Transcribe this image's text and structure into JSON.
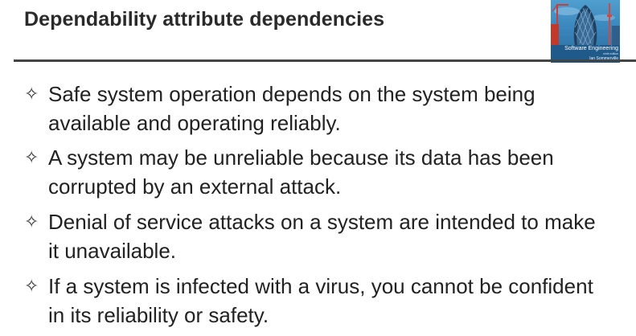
{
  "slide": {
    "title": "Dependability attribute dependencies",
    "cover": {
      "book_title": "Software Engineering",
      "edition": "ninth edition",
      "author": "Ian Sommerville",
      "colors": {
        "sky": "#4f9fcf",
        "band": "#1f5a8a",
        "tower": "#d9463b"
      }
    },
    "bullet_marker": "✧",
    "bullets": [
      {
        "text": "Safe system operation depends on the system being available and operating reliably."
      },
      {
        "text": "A system may be unreliable because its data has been corrupted by an external attack."
      },
      {
        "text": "Denial of service attacks on a system are intended to make it unavailable."
      },
      {
        "text": "If a system is infected with a virus, you cannot be confident in its reliability or safety."
      }
    ]
  }
}
